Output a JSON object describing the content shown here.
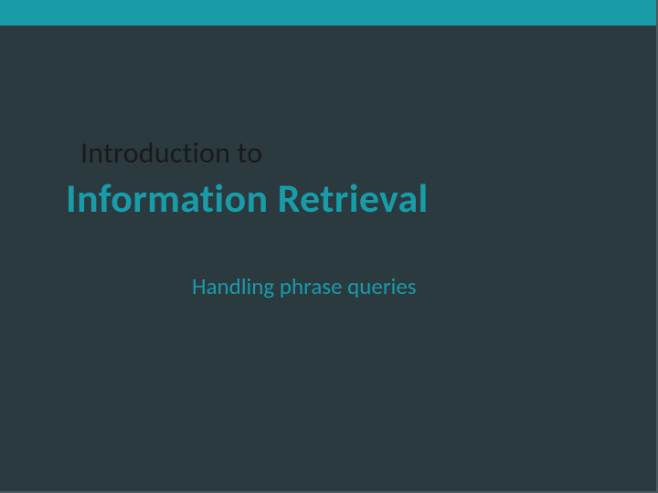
{
  "slide": {
    "kicker": "Introduction to",
    "title": "Information Retrieval",
    "subtitle": "Handling phrase queries"
  }
}
